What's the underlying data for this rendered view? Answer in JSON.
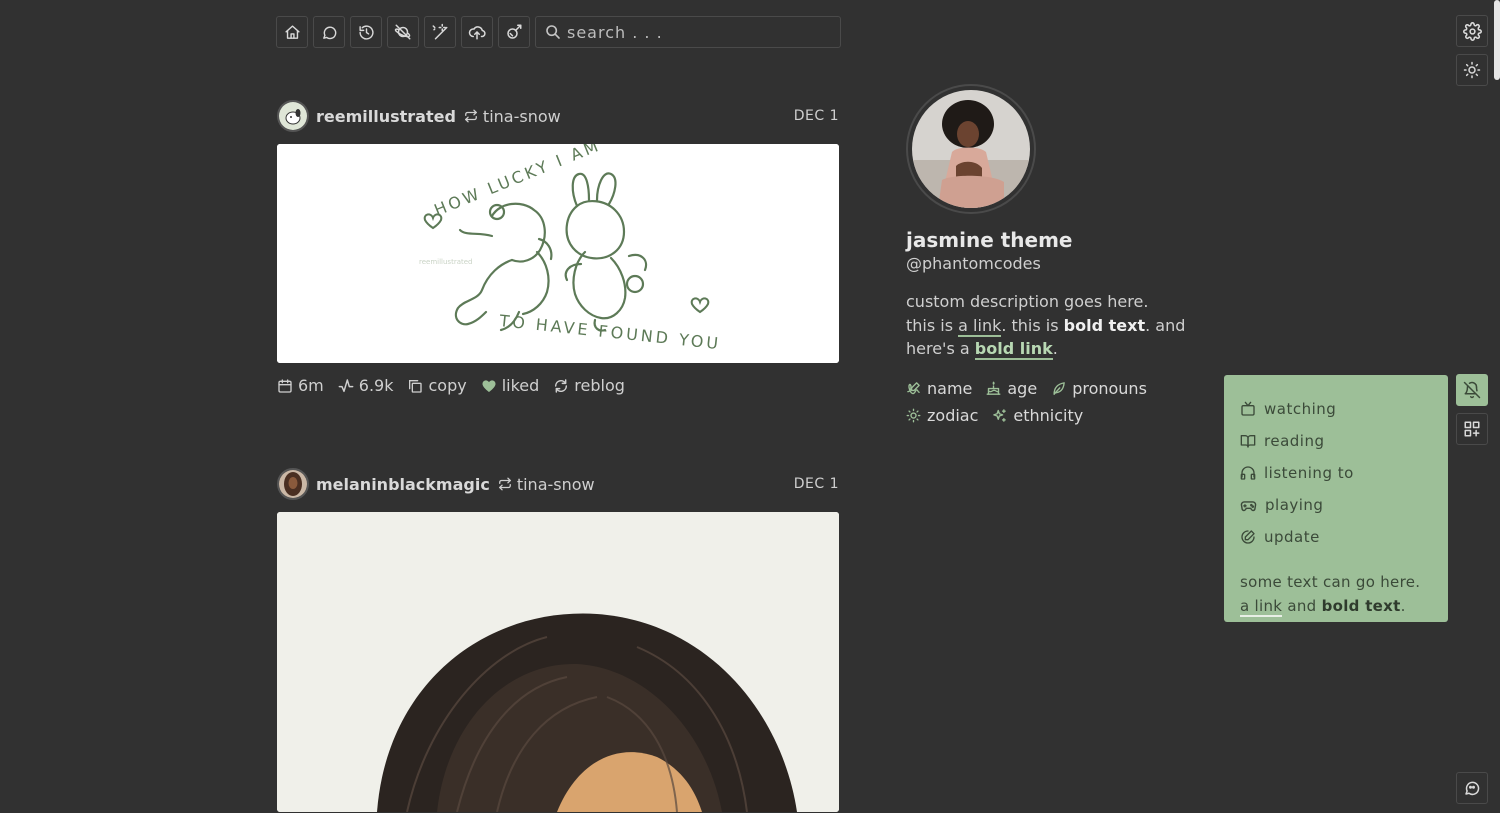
{
  "nav": {
    "icons": [
      "home-icon",
      "message-icon",
      "history-icon",
      "planet-icon",
      "wand-icon",
      "cloud-upload-icon",
      "brush-icon"
    ],
    "search_placeholder": "search . . ."
  },
  "posts": [
    {
      "username": "reemillustrated",
      "reblogged_from": "tina-snow",
      "date": "DEC 1",
      "image_text": {
        "top": "HOW LUCKY I AM",
        "bottom": "TO HAVE FOUND YOU",
        "signature": "reemillustrated"
      },
      "footer": {
        "time": "6m",
        "notes": "6.9k",
        "copy": "copy",
        "liked": "liked",
        "reblog": "reblog"
      }
    },
    {
      "username": "melaninblackmagic",
      "reblogged_from": "tina-snow",
      "date": "DEC 1"
    }
  ],
  "profile": {
    "title": "jasmine theme",
    "handle": "@phantomcodes",
    "desc": {
      "line1": "custom description goes here.",
      "p1": "this is ",
      "link": "a link",
      "p2": ". this is ",
      "bold": "bold text",
      "p3": ". and",
      "p4": "here's a ",
      "bold_link": "bold link",
      "p5": "."
    },
    "tags": {
      "name": "name",
      "age": "age",
      "pronouns": "pronouns",
      "zodiac": "zodiac",
      "ethnicity": "ethnicity"
    }
  },
  "panel": {
    "items": {
      "watching": "watching",
      "reading": "reading",
      "listening": "listening to",
      "playing": "playing",
      "update": "update"
    },
    "note": {
      "line1": "some text can go here.",
      "link": "a link",
      "mid": " and ",
      "bold": "bold text",
      "end": "."
    }
  },
  "colors": {
    "background": "#313131",
    "accent": "#9dbf98",
    "text": "#cfcfcf"
  }
}
